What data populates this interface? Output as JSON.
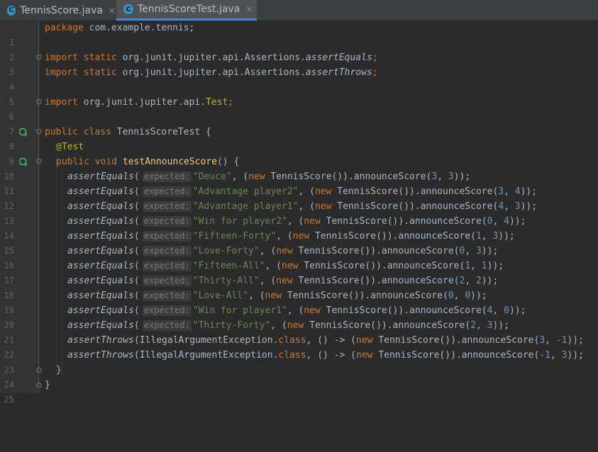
{
  "tabs": [
    {
      "label": "TennisScore.java",
      "icon": "class-icon",
      "active": false
    },
    {
      "label": "TennisScoreTest.java",
      "icon": "class-icon",
      "active": true
    }
  ],
  "tab_icon_letter": "C",
  "close_glyph": "×",
  "hint_label": "expected:",
  "lines": {
    "l1": {
      "n": "1",
      "kw": "package",
      "rest": " com.example.tennis;"
    },
    "l2": {
      "n": "2"
    },
    "l3": {
      "n": "3",
      "kw": "import static",
      "rest": " org.junit.jupiter.api.Assertions.",
      "it": "assertEquals",
      "end": ";"
    },
    "l4": {
      "n": "4",
      "kw": "import static",
      "rest": " org.junit.jupiter.api.Assertions.",
      "it": "assertThrows",
      "end": ";"
    },
    "l5": {
      "n": "5"
    },
    "l6": {
      "n": "6",
      "kw": "import",
      "rest": " org.junit.jupiter.api.",
      "ann": "Test",
      "end": ";"
    },
    "l7": {
      "n": "7"
    },
    "l8": {
      "n": "8",
      "kw": "public class",
      "rest": " TennisScoreTest {"
    },
    "l9": {
      "n": "9",
      "ann": "@Test"
    },
    "l10": {
      "n": "10",
      "kw": "public void",
      "fn": "testAnnounceScore",
      "end": "() {"
    },
    "l11": {
      "n": "11",
      "str": "\"Deuce\"",
      "a": "3",
      "b": "3"
    },
    "l12": {
      "n": "12",
      "str": "\"Advantage player2\"",
      "a": "3",
      "b": "4"
    },
    "l13": {
      "n": "13",
      "str": "\"Advantage player1\"",
      "a": "4",
      "b": "3"
    },
    "l14": {
      "n": "14",
      "str": "\"Win for player2\"",
      "a": "0",
      "b": "4"
    },
    "l15": {
      "n": "15",
      "str": "\"Fifteen-Forty\"",
      "a": "1",
      "b": "3"
    },
    "l16": {
      "n": "16",
      "str": "\"Love-Forty\"",
      "a": "0",
      "b": "3"
    },
    "l17": {
      "n": "17",
      "str": "\"Fifteen-All\"",
      "a": "1",
      "b": "1"
    },
    "l18": {
      "n": "18",
      "str": "\"Thirty-All\"",
      "a": "2",
      "b": "2"
    },
    "l19": {
      "n": "19",
      "str": "\"Love-All\"",
      "a": "0",
      "b": "0"
    },
    "l20": {
      "n": "20",
      "str": "\"Win for player1\"",
      "a": "4",
      "b": "0"
    },
    "l21": {
      "n": "21",
      "str": "\"Thirty-Forty\"",
      "a": "2",
      "b": "3"
    },
    "l22": {
      "n": "22",
      "a": "3",
      "b": "-1"
    },
    "l23": {
      "n": "23",
      "a": "-1",
      "b": "3"
    },
    "l24": {
      "n": "24",
      "end": "}"
    },
    "l25": {
      "n": "25",
      "end": "}"
    }
  },
  "tokens": {
    "assertEquals": "assertEquals",
    "assertThrows": "assertThrows",
    "open": "(",
    "comma_sp": ", (",
    "new": "new",
    "ctor": " TennisScore()).announceScore(",
    "comma": ", ",
    "close": "));",
    "exc": "IllegalArgumentException.",
    "class_kw": "class",
    "lambda": ", () -> ("
  }
}
